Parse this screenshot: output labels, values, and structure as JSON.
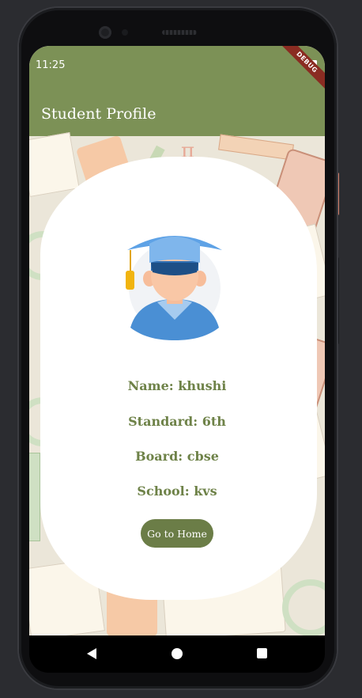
{
  "status_bar": {
    "time": "11:25",
    "debug_banner": "DEBUG"
  },
  "app_bar": {
    "title": "Student Profile",
    "color": "#7c9156"
  },
  "profile": {
    "avatar_icon": "graduate-student-avatar",
    "name_line": "Name: khushi",
    "standard_line": "Standard: 6th",
    "board_line": "Board: cbse",
    "school_line": "School: kvs",
    "text_color": "#6e8248"
  },
  "actions": {
    "go_home_label": "Go to Home",
    "button_color": "#6b7d47"
  },
  "navigation_bar": {
    "back_icon": "back-triangle-icon",
    "home_icon": "home-circle-icon",
    "recents_icon": "recents-square-icon"
  }
}
